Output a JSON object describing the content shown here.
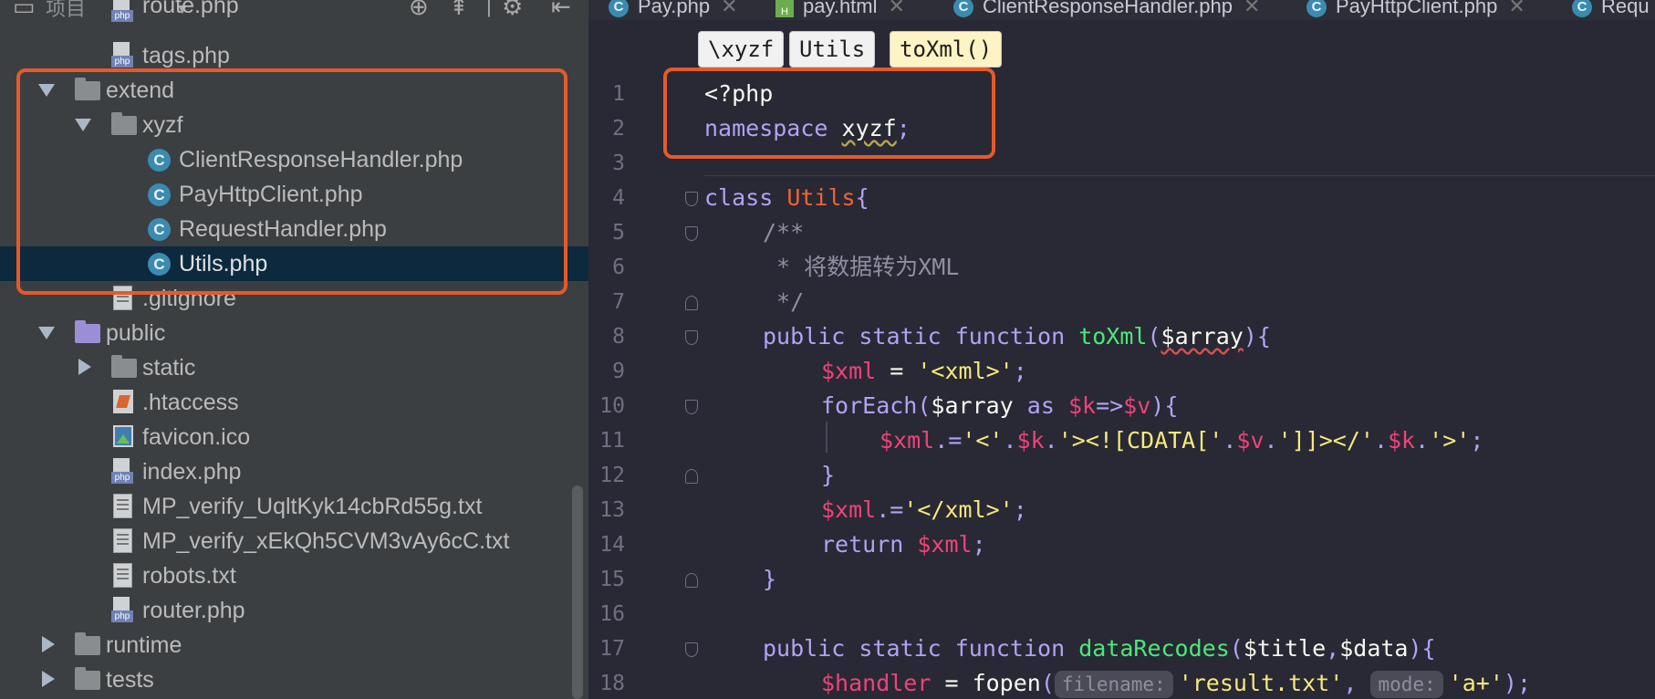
{
  "project_panel": {
    "title": "项目",
    "tree": [
      {
        "label": "route.php",
        "icon": "php-file-icon",
        "depth": 2
      },
      {
        "label": "tags.php",
        "icon": "php-file-icon",
        "depth": 2
      },
      {
        "label": "extend",
        "icon": "folder-icon",
        "depth": 1,
        "expanded": true
      },
      {
        "label": "xyzf",
        "icon": "folder-icon",
        "depth": 2,
        "expanded": true
      },
      {
        "label": "ClientResponseHandler.php",
        "icon": "php-class-icon",
        "depth": 3
      },
      {
        "label": "PayHttpClient.php",
        "icon": "php-class-icon",
        "depth": 3
      },
      {
        "label": "RequestHandler.php",
        "icon": "php-class-icon",
        "depth": 3
      },
      {
        "label": "Utils.php",
        "icon": "php-class-icon",
        "depth": 3,
        "selected": true
      },
      {
        "label": ".gitignore",
        "icon": "text-file-icon",
        "depth": 2
      },
      {
        "label": "public",
        "icon": "folder-icon",
        "depth": 1,
        "expanded": true
      },
      {
        "label": "static",
        "icon": "folder-icon",
        "depth": 2,
        "expanded": false
      },
      {
        "label": ".htaccess",
        "icon": "htaccess-file-icon",
        "depth": 2
      },
      {
        "label": "favicon.ico",
        "icon": "image-file-icon",
        "depth": 2
      },
      {
        "label": "index.php",
        "icon": "php-file-icon",
        "depth": 2
      },
      {
        "label": "MP_verify_UqltKyk14cbRd55g.txt",
        "icon": "text-file-icon",
        "depth": 2
      },
      {
        "label": "MP_verify_xEkQh5CVM3vAy6cC.txt",
        "icon": "text-file-icon",
        "depth": 2
      },
      {
        "label": "robots.txt",
        "icon": "text-file-icon",
        "depth": 2
      },
      {
        "label": "router.php",
        "icon": "php-file-icon",
        "depth": 2
      },
      {
        "label": "runtime",
        "icon": "folder-icon",
        "depth": 1,
        "expanded": false
      },
      {
        "label": "tests",
        "icon": "folder-icon",
        "depth": 1,
        "expanded": false
      }
    ]
  },
  "editor": {
    "tabs": [
      {
        "label": "Pay.php",
        "icon": "php-class-icon"
      },
      {
        "label": "pay.html",
        "icon": "html-file-icon"
      },
      {
        "label": "ClientResponseHandler.php",
        "icon": "php-class-icon"
      },
      {
        "label": "PayHttpClient.php",
        "icon": "php-class-icon"
      },
      {
        "label": "Requ",
        "icon": "php-class-icon"
      }
    ],
    "breadcrumbs": [
      "\\xyzf",
      "Utils",
      "toXml()"
    ],
    "line_numbers": [
      "1",
      "2",
      "3",
      "4",
      "5",
      "6",
      "7",
      "8",
      "9",
      "10",
      "11",
      "12",
      "13",
      "14",
      "15",
      "16",
      "17",
      "18"
    ],
    "code": {
      "l1": "<?php",
      "l2_kw": "namespace",
      "l2_ns": "xyzf",
      "l2_semi": ";",
      "l4_kw": "class",
      "l4_cls": "Utils",
      "l4_brace": "{",
      "l5": "/**",
      "l6": " * 将数据转为XML",
      "l7": " */",
      "l8_kw": "public static function",
      "l8_fn": "toXml",
      "l8_open": "(",
      "l8_arg": "$array",
      "l8_close": "){",
      "l9_var": "$xml",
      "l9_op": " = ",
      "l9_str": "'<xml>'",
      "l9_end": ";",
      "l10_kw": "forEach",
      "l10_open": "(",
      "l10_arr": "$array",
      "l10_as": " as ",
      "l10_k": "$k",
      "l10_arrow": "=>",
      "l10_v": "$v",
      "l10_close": "){",
      "l11_var": "$xml",
      "l11_op": ".=",
      "l11_s1": "'<'",
      "l11_d1": ".",
      "l11_k1": "$k",
      "l11_d2": ".",
      "l11_s2": "'><![CDATA['",
      "l11_d3": ".",
      "l11_v": "$v",
      "l11_d4": ".",
      "l11_s3": "']]></'",
      "l11_d5": ".",
      "l11_k2": "$k",
      "l11_d6": ".",
      "l11_s4": "'>'",
      "l11_end": ";",
      "l12": "}",
      "l13_var": "$xml",
      "l13_op": ".=",
      "l13_str": "'</xml>'",
      "l13_end": ";",
      "l14_kw": "return",
      "l14_var": "$xml",
      "l14_end": ";",
      "l15": "}",
      "l17_kw": "public static function",
      "l17_fn": "dataRecodes",
      "l17_open": "(",
      "l17_a1": "$title",
      "l17_comma": ",",
      "l17_a2": "$data",
      "l17_close": "){",
      "l18_var": "$handler",
      "l18_op": " = ",
      "l18_fn": "fopen",
      "l18_open": "(",
      "l18_hint1": "filename:",
      "l18_s1": "'result.txt'",
      "l18_comma": ",",
      "l18_hint2": "mode:",
      "l18_s2": "'a+'",
      "l18_close": ");"
    }
  },
  "colors": {
    "highlight_box": "#e55a2b",
    "selection": "#0d293e",
    "keyword": "#b3a2f5",
    "function": "#4ce87a",
    "variable": "#f1427a",
    "class_name": "#f06336"
  }
}
